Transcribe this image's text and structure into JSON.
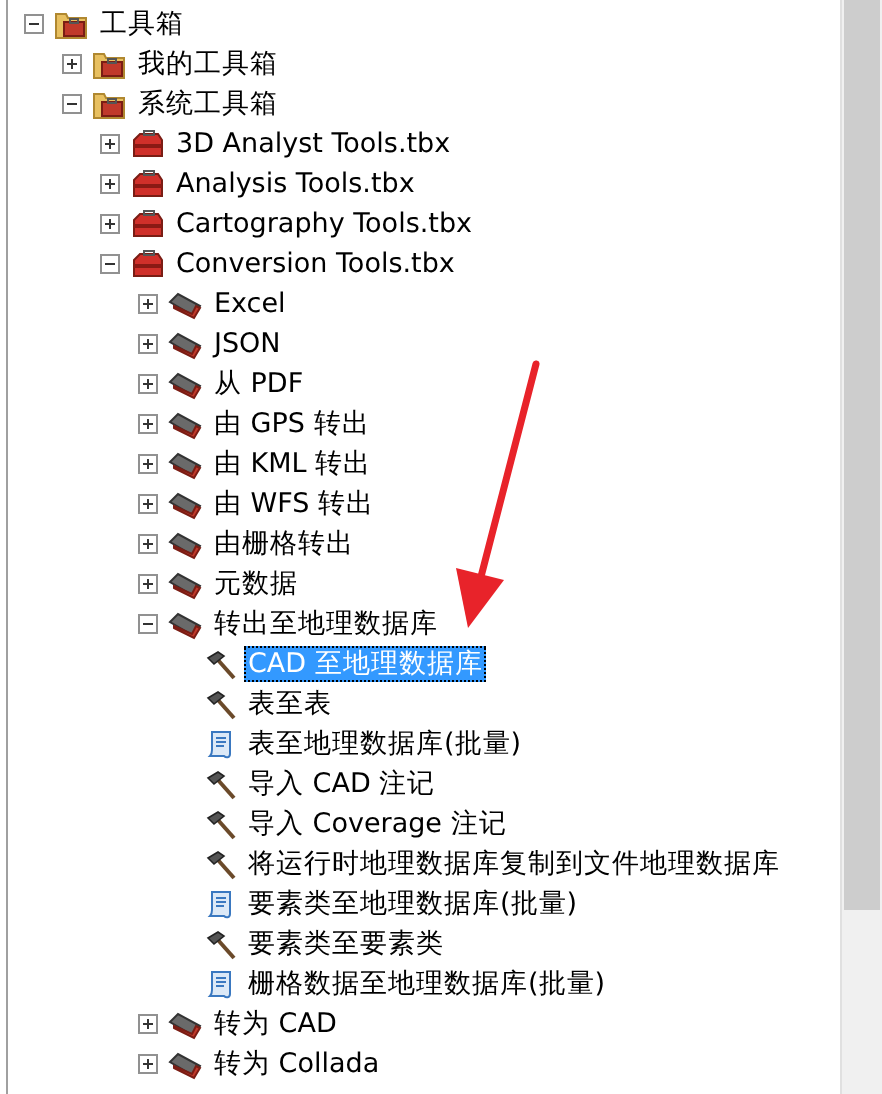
{
  "tree": [
    {
      "label": "工具箱",
      "kind": "folder",
      "expanded": true,
      "selected": false,
      "children": [
        {
          "label": "我的工具箱",
          "kind": "folder",
          "expanded": false,
          "selected": false
        },
        {
          "label": "系统工具箱",
          "kind": "folder",
          "expanded": true,
          "selected": false,
          "children": [
            {
              "label": "3D Analyst Tools.tbx",
              "kind": "toolbox",
              "expanded": false,
              "selected": false
            },
            {
              "label": "Analysis Tools.tbx",
              "kind": "toolbox",
              "expanded": false,
              "selected": false
            },
            {
              "label": "Cartography Tools.tbx",
              "kind": "toolbox",
              "expanded": false,
              "selected": false
            },
            {
              "label": "Conversion Tools.tbx",
              "kind": "toolbox",
              "expanded": true,
              "selected": false,
              "children": [
                {
                  "label": "Excel",
                  "kind": "toolset",
                  "expanded": false,
                  "selected": false
                },
                {
                  "label": "JSON",
                  "kind": "toolset",
                  "expanded": false,
                  "selected": false
                },
                {
                  "label": "从 PDF",
                  "kind": "toolset",
                  "expanded": false,
                  "selected": false
                },
                {
                  "label": "由 GPS 转出",
                  "kind": "toolset",
                  "expanded": false,
                  "selected": false
                },
                {
                  "label": "由 KML 转出",
                  "kind": "toolset",
                  "expanded": false,
                  "selected": false
                },
                {
                  "label": "由 WFS 转出",
                  "kind": "toolset",
                  "expanded": false,
                  "selected": false
                },
                {
                  "label": "由栅格转出",
                  "kind": "toolset",
                  "expanded": false,
                  "selected": false
                },
                {
                  "label": "元数据",
                  "kind": "toolset",
                  "expanded": false,
                  "selected": false
                },
                {
                  "label": "转出至地理数据库",
                  "kind": "toolset",
                  "expanded": true,
                  "selected": false,
                  "children": [
                    {
                      "label": "CAD 至地理数据库",
                      "kind": "tool",
                      "selected": true
                    },
                    {
                      "label": "表至表",
                      "kind": "tool",
                      "selected": false
                    },
                    {
                      "label": "表至地理数据库(批量)",
                      "kind": "script",
                      "selected": false
                    },
                    {
                      "label": "导入 CAD 注记",
                      "kind": "tool",
                      "selected": false
                    },
                    {
                      "label": "导入 Coverage 注记",
                      "kind": "tool",
                      "selected": false
                    },
                    {
                      "label": "将运行时地理数据库复制到文件地理数据库",
                      "kind": "tool",
                      "selected": false
                    },
                    {
                      "label": "要素类至地理数据库(批量)",
                      "kind": "script",
                      "selected": false
                    },
                    {
                      "label": "要素类至要素类",
                      "kind": "tool",
                      "selected": false
                    },
                    {
                      "label": "栅格数据至地理数据库(批量)",
                      "kind": "script",
                      "selected": false
                    }
                  ]
                },
                {
                  "label": "转为 CAD",
                  "kind": "toolset",
                  "expanded": false,
                  "selected": false
                },
                {
                  "label": "转为 Collada",
                  "kind": "toolset",
                  "expanded": false,
                  "selected": false
                }
              ]
            }
          ]
        }
      ]
    }
  ]
}
